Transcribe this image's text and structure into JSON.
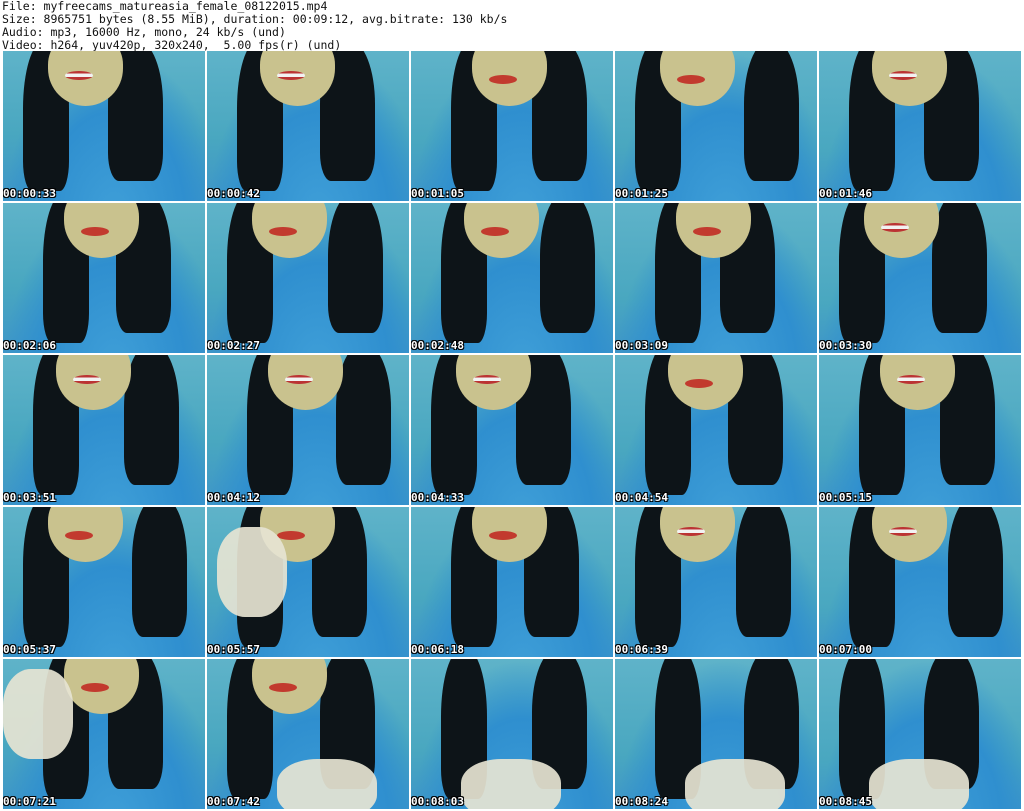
{
  "header": {
    "line1": "File: myfreecams_matureasia_female_08122015.mp4",
    "line2": "Size: 8965751 bytes (8.55 MiB), duration: 00:09:12, avg.bitrate: 130 kb/s",
    "line3": "Audio: mp3, 16000 Hz, mono, 24 kb/s (und)",
    "line4": "Video: h264, yuv420p, 320x240,  5.00 fps(r) (und)"
  },
  "thumbnails": [
    {
      "time": "00:00:33",
      "scene": "smile"
    },
    {
      "time": "00:00:42",
      "scene": "smile"
    },
    {
      "time": "00:01:05",
      "scene": "lips"
    },
    {
      "time": "00:01:25",
      "scene": "lips"
    },
    {
      "time": "00:01:46",
      "scene": "smile"
    },
    {
      "time": "00:02:06",
      "scene": "lips"
    },
    {
      "time": "00:02:27",
      "scene": "lips"
    },
    {
      "time": "00:02:48",
      "scene": "lips"
    },
    {
      "time": "00:03:09",
      "scene": "lips"
    },
    {
      "time": "00:03:30",
      "scene": "smile"
    },
    {
      "time": "00:03:51",
      "scene": "smile"
    },
    {
      "time": "00:04:12",
      "scene": "smile"
    },
    {
      "time": "00:04:33",
      "scene": "smile"
    },
    {
      "time": "00:04:54",
      "scene": "lips"
    },
    {
      "time": "00:05:15",
      "scene": "smile"
    },
    {
      "time": "00:05:37",
      "scene": "lips"
    },
    {
      "time": "00:05:57",
      "scene": "hand"
    },
    {
      "time": "00:06:18",
      "scene": "lips"
    },
    {
      "time": "00:06:39",
      "scene": "smile"
    },
    {
      "time": "00:07:00",
      "scene": "smile"
    },
    {
      "time": "00:07:21",
      "scene": "hand"
    },
    {
      "time": "00:07:42",
      "scene": "hands-low"
    },
    {
      "time": "00:08:03",
      "scene": "hands-low"
    },
    {
      "time": "00:08:24",
      "scene": "hands-low"
    },
    {
      "time": "00:08:45",
      "scene": "hands-low"
    }
  ],
  "colors": {
    "shirt": "#3f9fd8",
    "wall": "#5fb3c9",
    "hair": "#0d1418",
    "skin": "#c9c28e",
    "lips": "#c23a2e",
    "hand": "#e6e4d2"
  }
}
